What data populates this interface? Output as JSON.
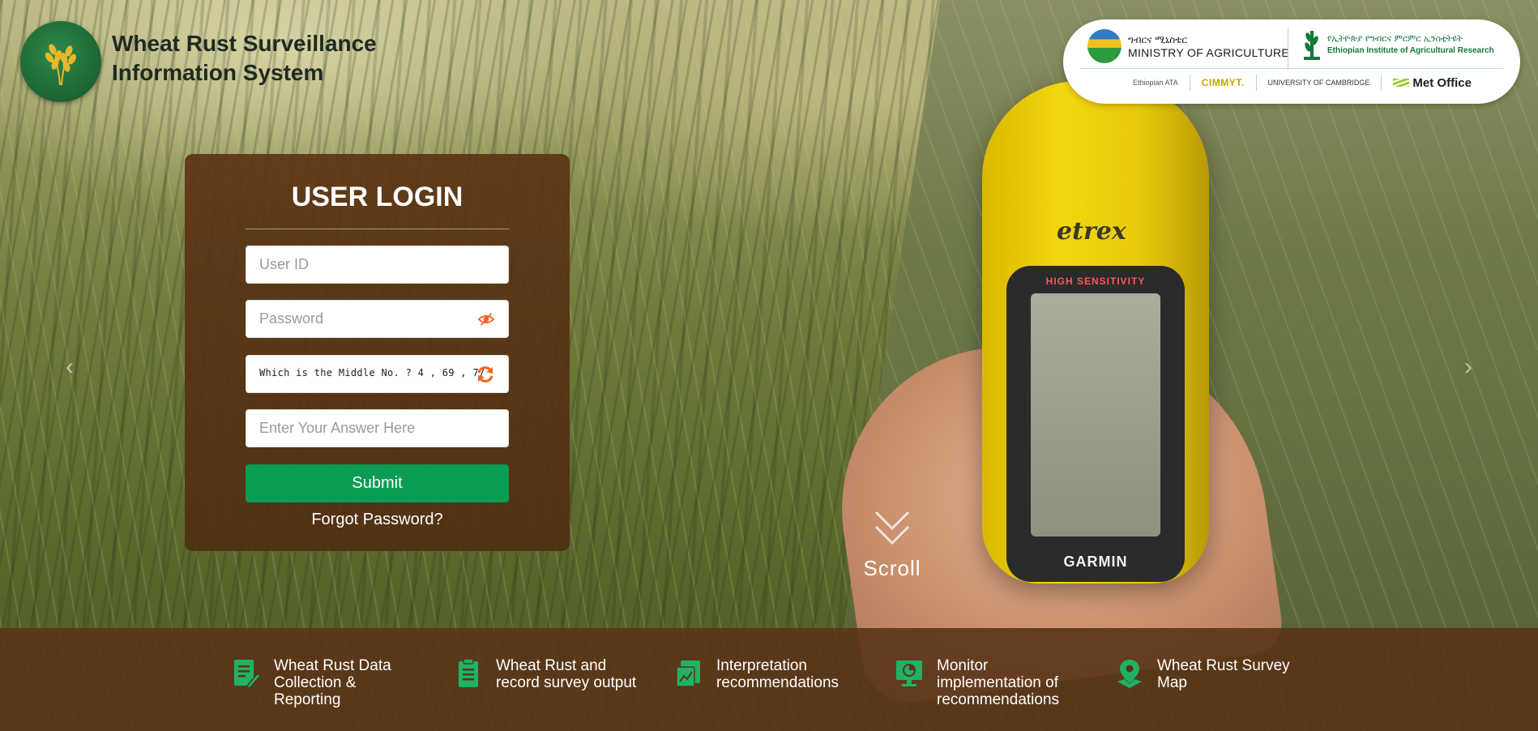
{
  "brand": {
    "title_line1": "Wheat Rust Surveillance",
    "title_line2": "Information System"
  },
  "partners": {
    "moa_amharic": "ግብርና ሚኒስቴር",
    "moa_english": "MINISTRY OF AGRICULTURE",
    "eiar_amharic": "የኢትዮጵያ የግብርና ምርምር ኢንስቲትዩት",
    "eiar_english": "Ethiopian Institute of Agricultural Research",
    "sponsors": [
      "Ethiopian ATA",
      "CIMMYT.",
      "UNIVERSITY OF CAMBRIDGE",
      "Met Office"
    ]
  },
  "login": {
    "title": "USER LOGIN",
    "user_placeholder": "User ID",
    "password_placeholder": "Password",
    "captcha_question": "Which is the Middle No. ? 4 , 69 , 77",
    "answer_placeholder": "Enter Your Answer Here",
    "submit_label": "Submit",
    "forgot_label": "Forgot Password?"
  },
  "device": {
    "brand": "etrex",
    "screen_header": "HIGH SENSITIVITY",
    "maker": "GARMIN"
  },
  "scroll": {
    "label": "Scroll"
  },
  "features": [
    {
      "icon": "edit-document-icon",
      "label": "Wheat Rust Data Collection & Reporting"
    },
    {
      "icon": "clipboard-icon",
      "label": "Wheat Rust and record survey output"
    },
    {
      "icon": "report-analysis-icon",
      "label": "Interpretation recommendations"
    },
    {
      "icon": "monitor-chart-icon",
      "label": "Monitor implementation of recommendations"
    },
    {
      "icon": "map-pin-icon",
      "label": "Wheat Rust Survey Map"
    }
  ],
  "colors": {
    "accent_green": "#0a9c52",
    "icon_green": "#1fb265",
    "card_brown": "#5c3414",
    "refresh_orange": "#f26522"
  }
}
